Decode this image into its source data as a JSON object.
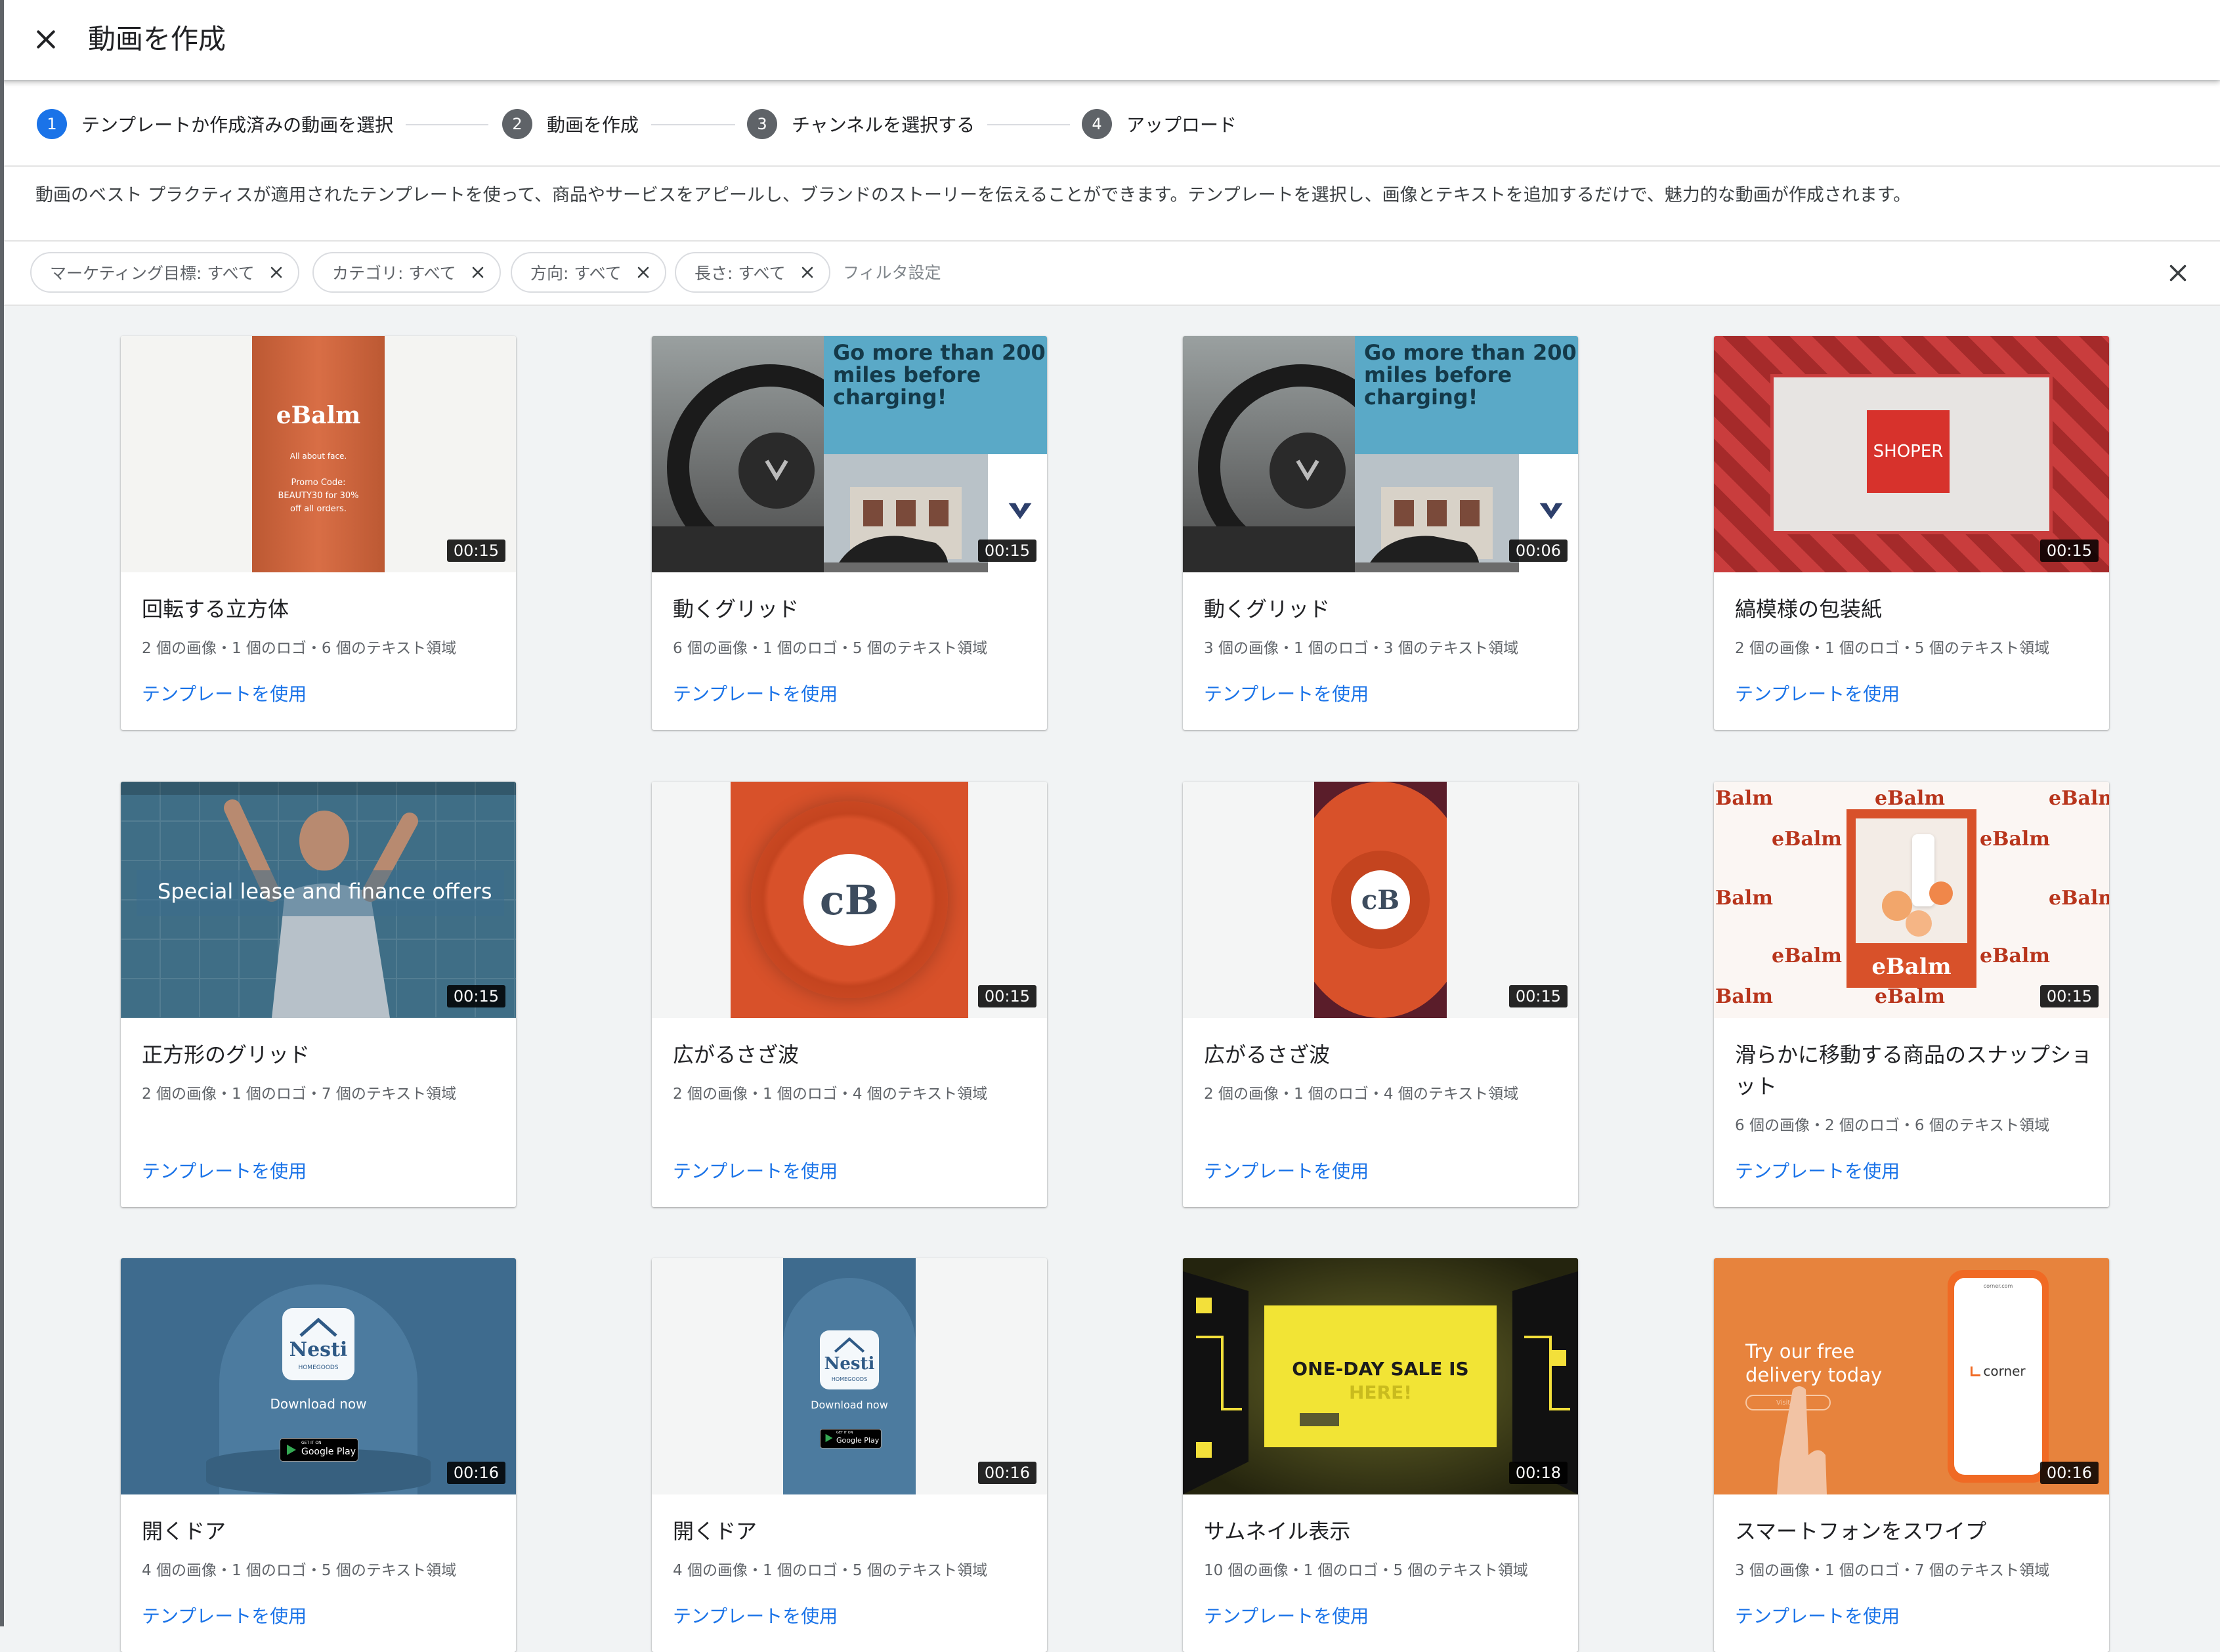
{
  "header": {
    "title": "動画を作成",
    "close_icon": "close-icon"
  },
  "stepper": [
    {
      "num": "1",
      "label": "テンプレートか作成済みの動画を選択"
    },
    {
      "num": "2",
      "label": "動画を作成"
    },
    {
      "num": "3",
      "label": "チャンネルを選択する"
    },
    {
      "num": "4",
      "label": "アップロード"
    }
  ],
  "description": "動画のベスト プラクティスが適用されたテンプレートを使って、商品やサービスをアピールし、ブランドのストーリーを伝えることができます。テンプレートを選択し、画像とテキストを追加するだけで、魅力的な動画が作成されます。",
  "filters": {
    "chips": [
      {
        "label": "マーケティング目標: すべて"
      },
      {
        "label": "カテゴリ: すべて"
      },
      {
        "label": "方向: すべて"
      },
      {
        "label": "長さ: すべて"
      }
    ],
    "settings_label": "フィルタ設定"
  },
  "colors": {
    "accent": "#1a73e8",
    "background": "#f1f3f4"
  },
  "thumb_text": {
    "ebalm": "eBalm",
    "ebalm_tag": "All about face.",
    "ebalm_promo": "Promo Code:",
    "ebalm_code": "BEAUTY30 for 30%",
    "ebalm_off": "off all orders.",
    "grid_line1": "Go more than 200",
    "grid_line2": "miles before",
    "grid_line3": "charging!",
    "shoper": "SHOPER",
    "square": "Special lease and finance offers",
    "cb": "cB",
    "balm_short": "Balm",
    "nesti": "Nesti",
    "homegoods": "HOMEGOODS",
    "download": "Download now",
    "gp_small": "GET IT ON",
    "gp": "Google Play",
    "sale1": "ONE-DAY SALE IS",
    "sale2": "HERE!",
    "try1": "Try our free",
    "try2": "delivery today",
    "visit": "Visit us",
    "corner_url": "corner.com",
    "corner": "corner"
  },
  "templates": [
    {
      "title": "回転する立方体",
      "meta": "2 個の画像・1 個のロゴ・6 個のテキスト領域",
      "duration": "00:15",
      "link": "テンプレートを使用"
    },
    {
      "title": "動くグリッド",
      "meta": "6 個の画像・1 個のロゴ・5 個のテキスト領域",
      "duration": "00:15",
      "link": "テンプレートを使用"
    },
    {
      "title": "動くグリッド",
      "meta": "3 個の画像・1 個のロゴ・3 個のテキスト領域",
      "duration": "00:06",
      "link": "テンプレートを使用"
    },
    {
      "title": "縞模様の包装紙",
      "meta": "2 個の画像・1 個のロゴ・5 個のテキスト領域",
      "duration": "00:15",
      "link": "テンプレートを使用"
    },
    {
      "title": "正方形のグリッド",
      "meta": "2 個の画像・1 個のロゴ・7 個のテキスト領域",
      "duration": "00:15",
      "link": "テンプレートを使用"
    },
    {
      "title": "広がるさざ波",
      "meta": "2 個の画像・1 個のロゴ・4 個のテキスト領域",
      "duration": "00:15",
      "link": "テンプレートを使用"
    },
    {
      "title": "広がるさざ波",
      "meta": "2 個の画像・1 個のロゴ・4 個のテキスト領域",
      "duration": "00:15",
      "link": "テンプレートを使用"
    },
    {
      "title": "滑らかに移動する商品のスナップショット",
      "meta": "6 個の画像・2 個のロゴ・6 個のテキスト領域",
      "duration": "00:15",
      "link": "テンプレートを使用"
    },
    {
      "title": "開くドア",
      "meta": "4 個の画像・1 個のロゴ・5 個のテキスト領域",
      "duration": "00:16",
      "link": "テンプレートを使用"
    },
    {
      "title": "開くドア",
      "meta": "4 個の画像・1 個のロゴ・5 個のテキスト領域",
      "duration": "00:16",
      "link": "テンプレートを使用"
    },
    {
      "title": "サムネイル表示",
      "meta": "10 個の画像・1 個のロゴ・5 個のテキスト領域",
      "duration": "00:18",
      "link": "テンプレートを使用"
    },
    {
      "title": "スマートフォンをスワイプ",
      "meta": "3 個の画像・1 個のロゴ・7 個のテキスト領域",
      "duration": "00:16",
      "link": "テンプレートを使用"
    }
  ]
}
